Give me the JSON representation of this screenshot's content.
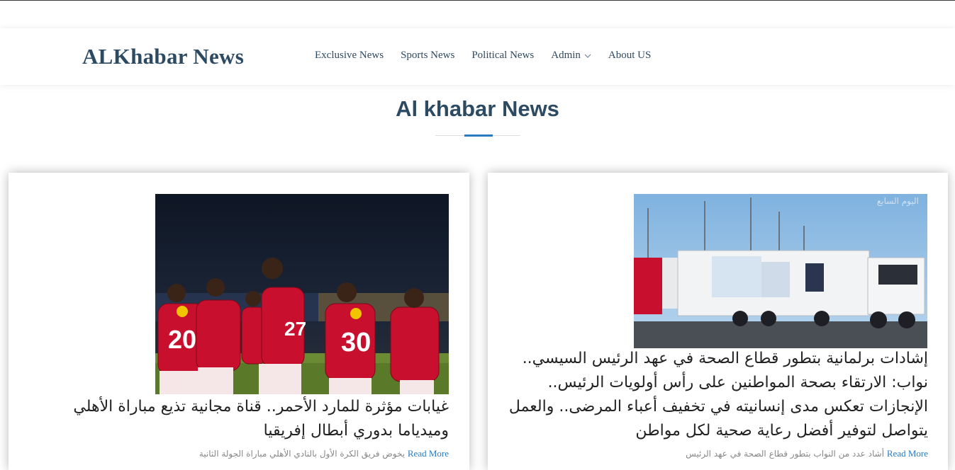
{
  "brand": "ALKhabar News",
  "nav": {
    "items": [
      {
        "label": "Exclusive News"
      },
      {
        "label": "Sports News"
      },
      {
        "label": "Political News"
      },
      {
        "label": "Admin"
      },
      {
        "label": "About US"
      }
    ]
  },
  "section": {
    "title": "Al khabar News"
  },
  "cards": [
    {
      "headline": "غيابات مؤثرة للمارد الأحمر.. قناة مجانية تذيع مباراة الأهلي وميدياما بدوري أبطال إفريقيا",
      "excerpt": "يخوض فريق الكرة الأول بالنادي الأهلي مباراة الجولة الثانية",
      "read_more": "Read More"
    },
    {
      "headline": "إشادات برلمانية بتطور قطاع الصحة في عهد الرئيس السيسي.. نواب: الارتقاء بصحة المواطنين على رأس أولويات الرئيس.. الإنجازات تعكس مدى إنسانيته في تخفيف أعباء المرضى.. والعمل يتواصل لتوفير أفضل رعاية صحية لكل مواطن",
      "excerpt": "أشاد عدد من النواب بتطور قطاع الصحة في عهد الرئيس",
      "read_more": "Read More",
      "photo_watermark": "اليوم السابع"
    }
  ],
  "colors": {
    "brand": "#2d4a63",
    "accent": "#2a7ac0",
    "jersey_red": "#c8102e"
  }
}
